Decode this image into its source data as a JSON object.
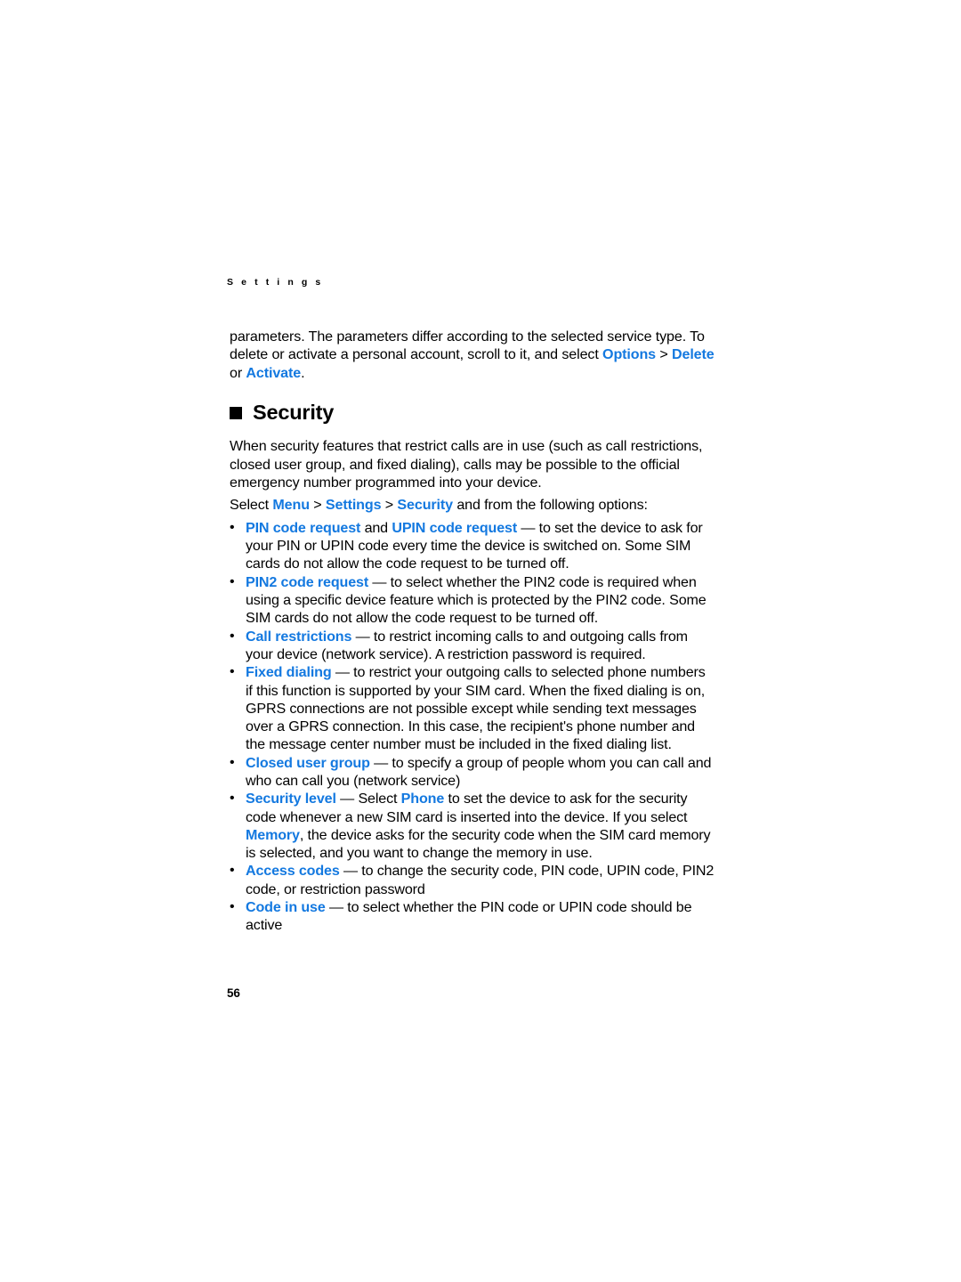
{
  "page": {
    "running_head": "S e t t i n g s",
    "folio": "56",
    "accent_color": "#1479e0",
    "text_color": "#000000",
    "background_color": "#ffffff"
  },
  "intro_paragraph": {
    "line1": "parameters. The parameters differ according to the selected service type. To",
    "line2_before": "delete or activate a personal account, scroll to it, and select ",
    "options_label": "Options",
    "chevron": " > ",
    "delete_label": "Delete",
    "or_text": " or ",
    "activate_label": "Activate",
    "period": "."
  },
  "section": {
    "bullet_glyph": "square",
    "title": "Security",
    "intro": "When security features that restrict calls are in use (such as call restrictions, closed user group, and fixed dialing), calls may be possible to the official emergency number programmed into your device.",
    "path_prefix": "Select ",
    "path_menu": "Menu",
    "path_sep1": " > ",
    "path_settings": "Settings",
    "path_sep2": " > ",
    "path_security": "Security",
    "path_suffix": " and from the following options:"
  },
  "options": [
    {
      "bullet": "•",
      "term": "PIN code request",
      "conjunction": " and ",
      "term2": "UPIN code request",
      "body": " — to set the device to ask for your PIN or UPIN code every time the device is switched on. Some SIM cards do not allow the code request to be turned off."
    },
    {
      "bullet": "•",
      "term": "PIN2 code request",
      "body": " — to select whether the PIN2 code is required when using a specific device feature which is protected by the PIN2 code. Some SIM cards do not allow the code request to be turned off."
    },
    {
      "bullet": "•",
      "term": "Call restrictions",
      "body": " — to restrict incoming calls to and outgoing calls from your device (network service). A restriction password is required."
    },
    {
      "bullet": "•",
      "term": "Fixed dialing",
      "body": " — to restrict your outgoing calls to selected phone numbers if this function is supported by your SIM card. When the fixed dialing is on, GPRS connections are not possible except while sending text messages over a GPRS connection. In this case, the recipient's phone number and the message center number must be included in the fixed dialing list."
    },
    {
      "bullet": "•",
      "term": "Closed user group",
      "body": " — to specify a group of people whom you can call and who can call you (network service)"
    },
    {
      "bullet": "•",
      "term": "Security level",
      "body_a": " — Select ",
      "inline_term_1": "Phone",
      "body_b": " to set the device to ask for the security code whenever a new SIM card is inserted into the device. If you select ",
      "inline_term_2": "Memory",
      "body_c": ", the device asks for the security code when the SIM card memory is selected, and you want to change the memory in use."
    },
    {
      "bullet": "•",
      "term": "Access codes",
      "body": " — to change the security code, PIN code, UPIN code, PIN2 code, or restriction password"
    },
    {
      "bullet": "•",
      "term": "Code in use",
      "body": " — to select whether the PIN code or UPIN code should be active"
    }
  ]
}
